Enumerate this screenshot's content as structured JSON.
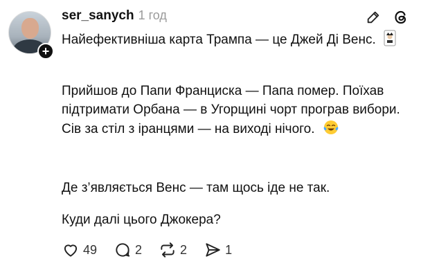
{
  "post": {
    "username": "ser_sanych",
    "time": "1 год",
    "paragraphs": [
      "Найефективніша карта Трампа — це Джей Ді Венс.",
      "Прийшов до Папи Франциска — Папа помер. Поїхав підтримати Орбана — в Угорщині чорт програв вибори. Сів за стіл з іранцями — на виході нічого.",
      "Де з’являється Венс — там щось іде не так.",
      "Куди далі цього Джокера?"
    ]
  },
  "actions": {
    "likes": "49",
    "replies": "2",
    "reposts": "2",
    "shares": "1"
  },
  "icons": {
    "follow": "plus-icon",
    "edit": "pencil-icon",
    "app": "threads-logo-icon",
    "like": "heart-icon",
    "reply": "comment-icon",
    "repost": "repost-icon",
    "share": "send-icon",
    "emoji1": "joker-card-emoji",
    "emoji2": "tears-of-joy-emoji"
  }
}
